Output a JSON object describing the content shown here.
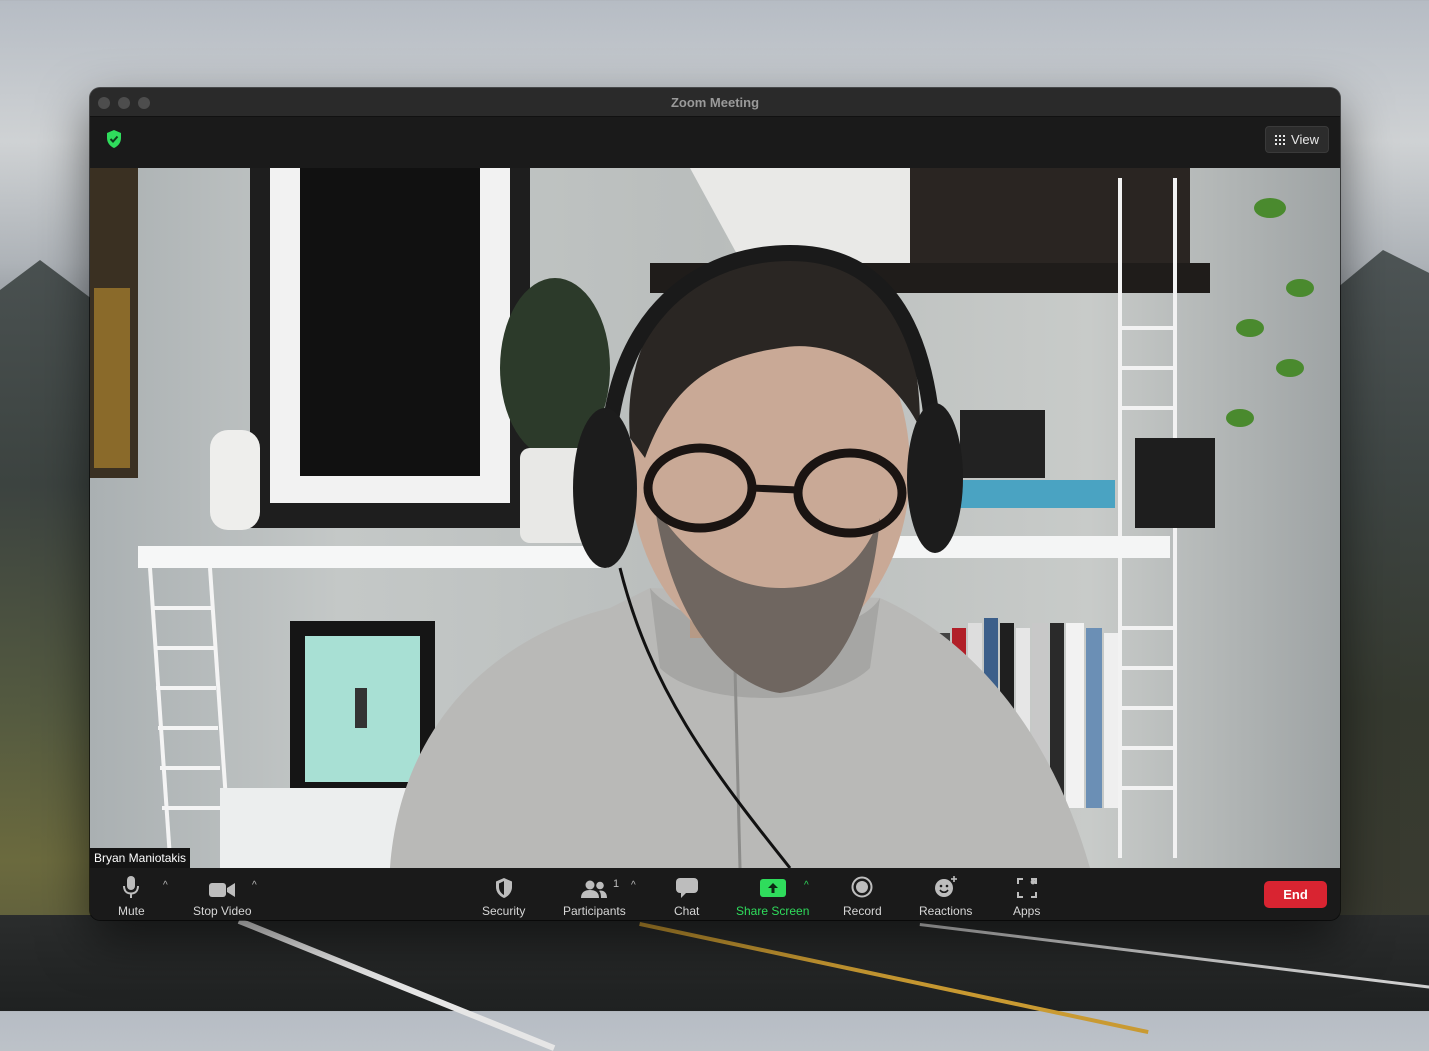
{
  "window": {
    "title": "Zoom Meeting",
    "view_label": "View"
  },
  "participant": {
    "name": "Bryan Maniotakis"
  },
  "toolbar": {
    "mute_label": "Mute",
    "stop_video_label": "Stop Video",
    "security_label": "Security",
    "participants_label": "Participants",
    "participants_count": "1",
    "chat_label": "Chat",
    "share_screen_label": "Share Screen",
    "record_label": "Record",
    "reactions_label": "Reactions",
    "apps_label": "Apps",
    "end_label": "End"
  },
  "icons": {
    "security_badge": "shield-check-icon",
    "view": "grid-icon",
    "mute": "microphone-icon",
    "stop_video": "video-camera-icon",
    "security": "shield-icon",
    "participants": "people-icon",
    "chat": "chat-bubble-icon",
    "share_screen": "share-screen-icon",
    "record": "record-icon",
    "reactions": "emoji-plus-icon",
    "apps": "apps-icon"
  },
  "colors": {
    "accent_green": "#2fdc5c",
    "end_red": "#d92431",
    "toolbar_bg": "#1a1a1a"
  }
}
